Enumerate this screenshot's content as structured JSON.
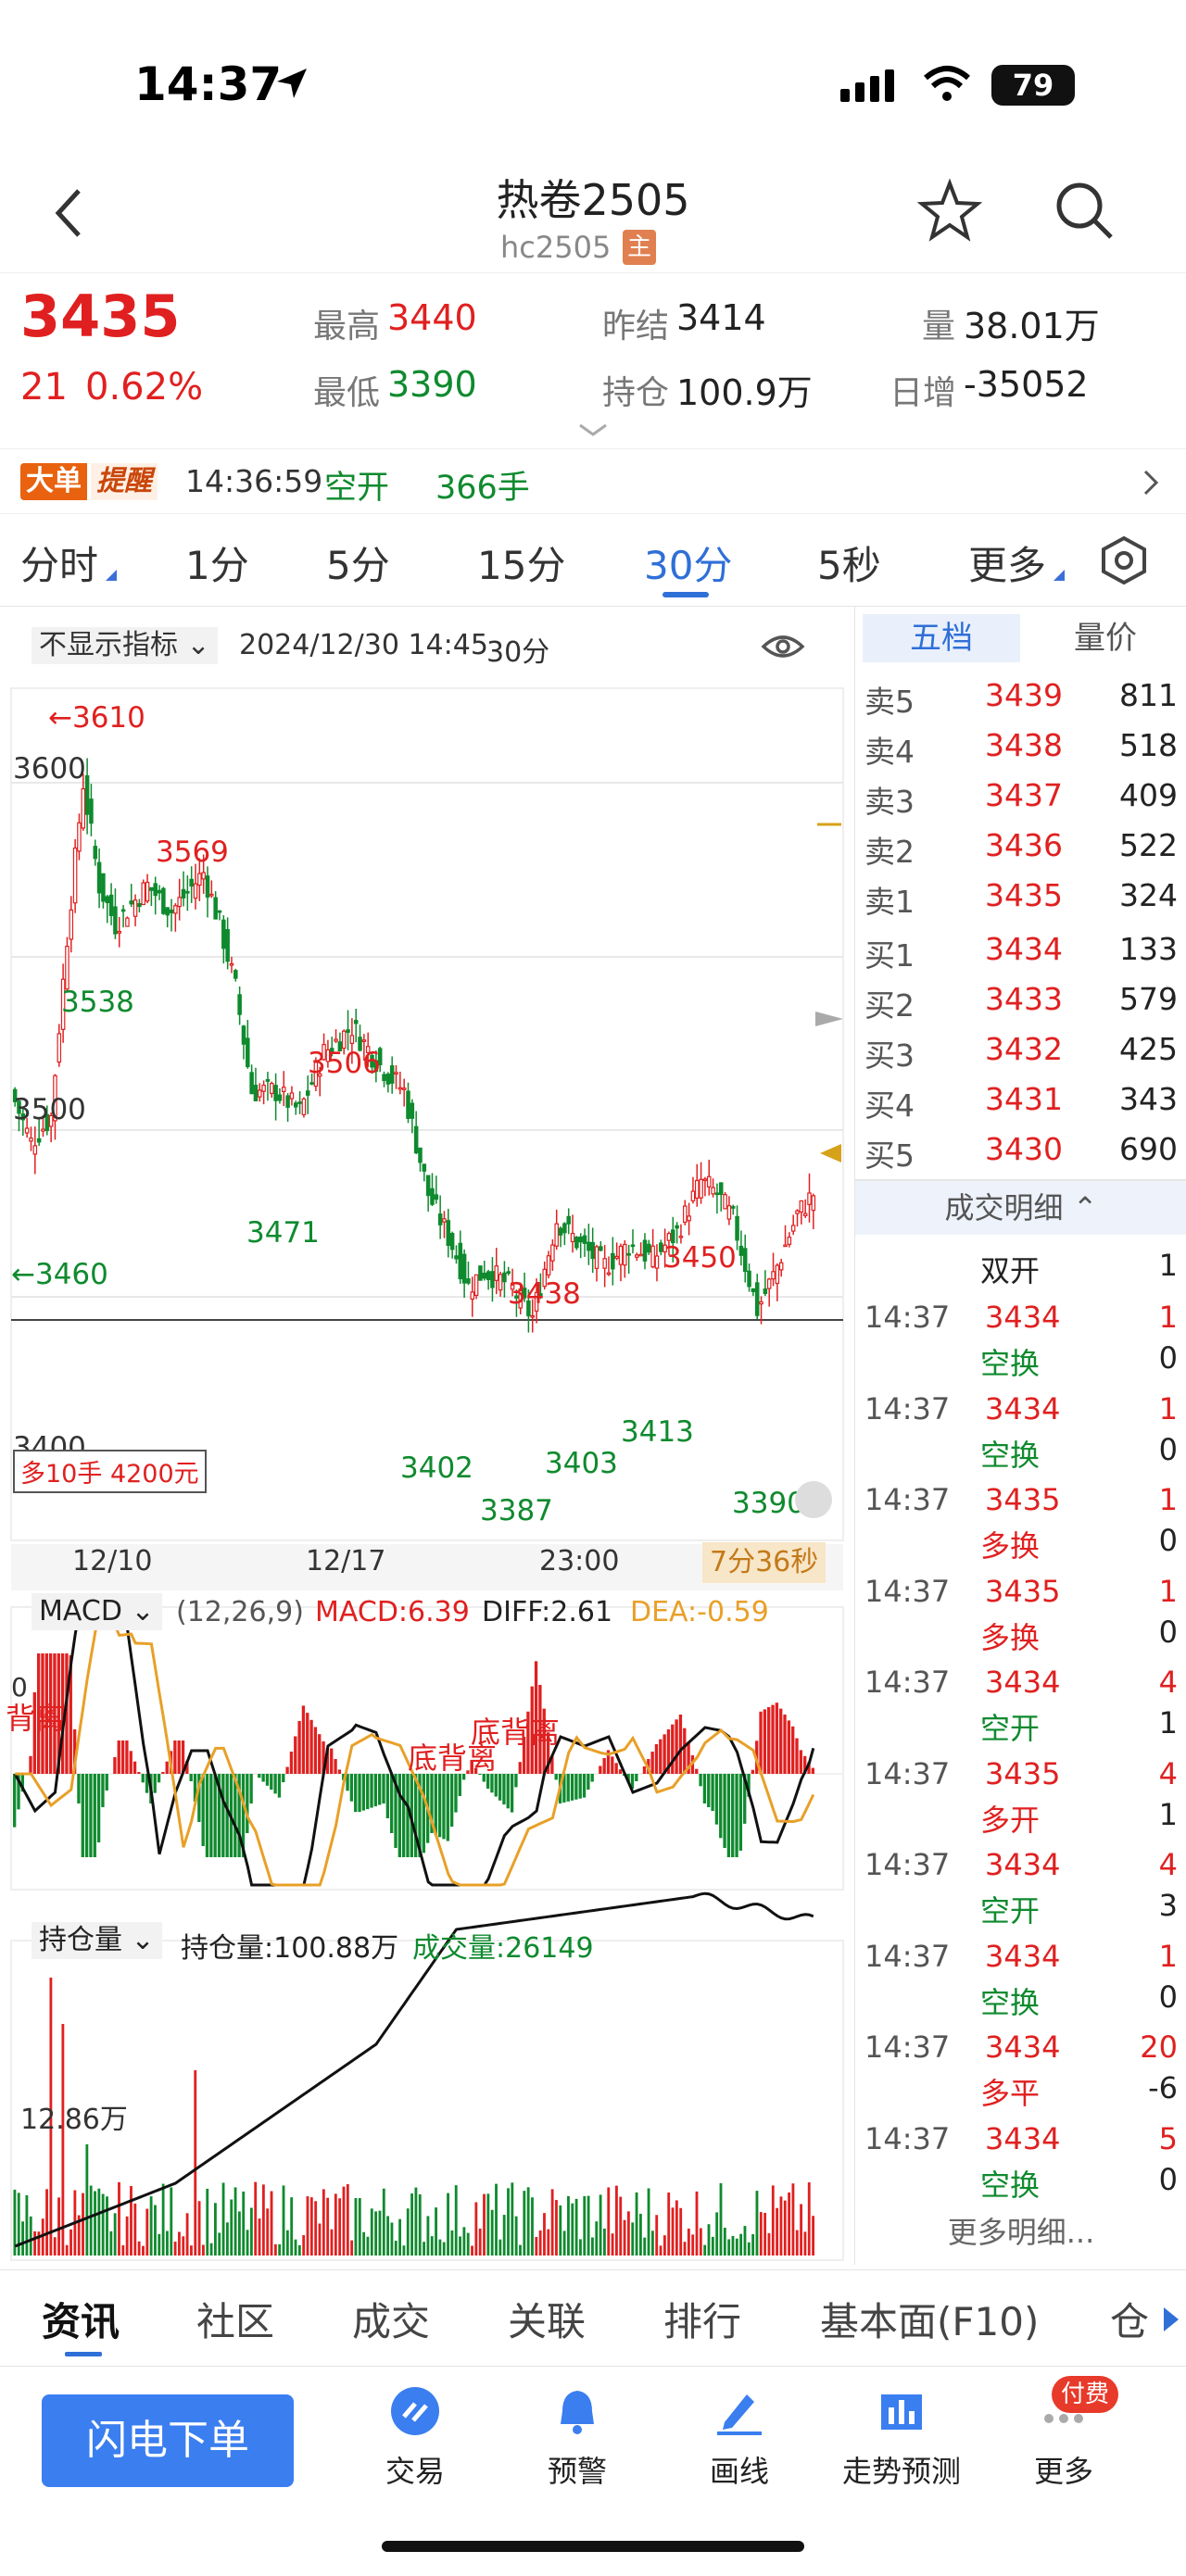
{
  "status": {
    "time": "14:37",
    "battery": "79"
  },
  "header": {
    "title": "热卷2505",
    "code": "hc2505",
    "main_badge": "主"
  },
  "quote": {
    "last": "3435",
    "change": "21",
    "change_pct": "0.62%",
    "high_label": "最高",
    "high": "3440",
    "low_label": "最低",
    "low": "3390",
    "prev_settle_label": "昨结",
    "prev_settle": "3414",
    "open_int_label": "持仓",
    "open_int": "100.9万",
    "volume_label": "量",
    "volume": "38.01万",
    "daily_inc_label": "日增",
    "daily_inc": "-35052"
  },
  "alert": {
    "badge1": "大单",
    "badge2": "提醒",
    "time": "14:36:59",
    "type": "空开",
    "qty": "366手"
  },
  "periods": [
    "分时",
    "1分",
    "5分",
    "15分",
    "30分",
    "5秒",
    "更多"
  ],
  "chart_header": {
    "indicator_select": "不显示指标",
    "datetime": "2024/12/30 14:45",
    "period": "30分"
  },
  "price_labels": {
    "max": "←3610",
    "min_left": "←3460",
    "p3569": "3569",
    "p3538": "3538",
    "p3506": "3506",
    "p3471": "3471",
    "p3438": "3438",
    "p3450": "3450",
    "p3413": "3413",
    "p3402": "3402",
    "p3403": "3403",
    "p3387": "3387",
    "p3390": "3390"
  },
  "y_ticks": [
    "3600",
    "3500",
    "3400"
  ],
  "position_box": "多10手 4200元",
  "x_ticks": [
    "12/10",
    "12/17",
    "23:00"
  ],
  "countdown": "7分36秒",
  "macd": {
    "select": "MACD",
    "params": "(12,26,9)",
    "macd": "MACD:6.39",
    "diff": "DIFF:2.61",
    "dea": "DEA:-0.59",
    "div1": "背离",
    "div2": "底背离",
    "div3": "底背离"
  },
  "oi_panel": {
    "select": "持仓量",
    "oi": "持仓量:100.88万",
    "vol": "成交量:26149",
    "vol_tick": "12.86万"
  },
  "orderbook": {
    "tab_active": "五档",
    "tab_other": "量价",
    "asks": [
      {
        "label": "卖5",
        "price": "3439",
        "vol": "811"
      },
      {
        "label": "卖4",
        "price": "3438",
        "vol": "518"
      },
      {
        "label": "卖3",
        "price": "3437",
        "vol": "409"
      },
      {
        "label": "卖2",
        "price": "3436",
        "vol": "522"
      },
      {
        "label": "卖1",
        "price": "3435",
        "vol": "324"
      }
    ],
    "bids": [
      {
        "label": "买1",
        "price": "3434",
        "vol": "133"
      },
      {
        "label": "买2",
        "price": "3433",
        "vol": "579"
      },
      {
        "label": "买3",
        "price": "3432",
        "vol": "425"
      },
      {
        "label": "买4",
        "price": "3431",
        "vol": "343"
      },
      {
        "label": "买5",
        "price": "3430",
        "vol": "690"
      }
    ],
    "detail_header": "成交明细",
    "first_type": "双开",
    "first_vol": "1",
    "trades": [
      {
        "time": "14:37",
        "price": "3434",
        "vol": "1",
        "type": "空换",
        "oi": "0"
      },
      {
        "time": "14:37",
        "price": "3434",
        "vol": "1",
        "type": "空换",
        "oi": "0"
      },
      {
        "time": "14:37",
        "price": "3435",
        "vol": "1",
        "type": "多换",
        "oi": "0"
      },
      {
        "time": "14:37",
        "price": "3435",
        "vol": "1",
        "type": "多换",
        "oi": "0"
      },
      {
        "time": "14:37",
        "price": "3434",
        "vol": "4",
        "type": "空开",
        "oi": "1"
      },
      {
        "time": "14:37",
        "price": "3435",
        "vol": "4",
        "type": "多开",
        "oi": "1"
      },
      {
        "time": "14:37",
        "price": "3434",
        "vol": "4",
        "type": "空开",
        "oi": "3"
      },
      {
        "time": "14:37",
        "price": "3434",
        "vol": "1",
        "type": "空换",
        "oi": "0"
      },
      {
        "time": "14:37",
        "price": "3434",
        "vol": "20",
        "type": "多平",
        "oi": "-6"
      },
      {
        "time": "14:37",
        "price": "3434",
        "vol": "5",
        "type": "空换",
        "oi": "0"
      }
    ],
    "more": "更多明细..."
  },
  "bottom_tabs": [
    "资讯",
    "社区",
    "成交",
    "关联",
    "排行",
    "基本面(F10)",
    "仓"
  ],
  "toolbar": {
    "flash_order": "闪电下单",
    "trade": "交易",
    "alert": "预警",
    "draw": "画线",
    "forecast": "走势预测",
    "more": "更多",
    "paid_badge": "付费"
  }
}
